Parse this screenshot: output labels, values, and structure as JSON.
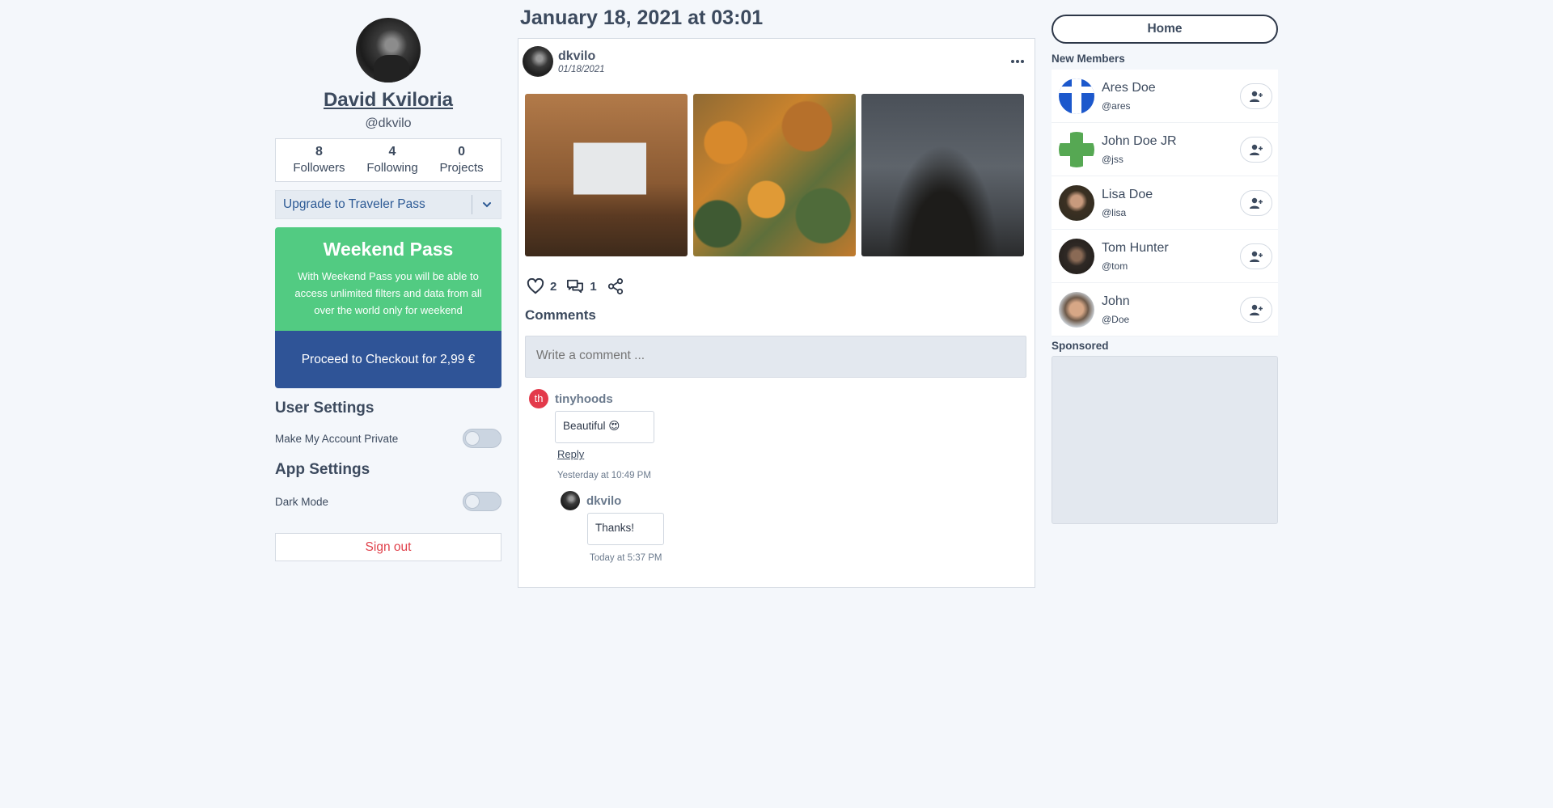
{
  "profile": {
    "name": "David Kviloria",
    "handle": "@dkvilo",
    "stats": [
      {
        "value": "8",
        "label": "Followers"
      },
      {
        "value": "4",
        "label": "Following"
      },
      {
        "value": "0",
        "label": "Projects"
      }
    ]
  },
  "upgrade": {
    "label": "Upgrade to Traveler Pass"
  },
  "pass": {
    "title": "Weekend Pass",
    "description": "With Weekend Pass you will be able to access unlimited filters and data from all over the world only for weekend",
    "checkout_label": "Proceed to Checkout for 2,99 €"
  },
  "user_settings": {
    "heading": "User Settings",
    "private_label": "Make My Account Private",
    "private_on": false
  },
  "app_settings": {
    "heading": "App Settings",
    "dark_mode_label": "Dark Mode",
    "dark_mode_on": false
  },
  "signout_label": "Sign out",
  "post": {
    "date_heading": "January 18, 2021 at 03:01",
    "author": "dkvilo",
    "date": "01/18/2021",
    "likes": "2",
    "comments_count": "1",
    "comments_heading": "Comments",
    "comment_placeholder": "Write a comment ...",
    "comments": [
      {
        "avatar_initials": "th",
        "author": "tinyhoods",
        "text": "Beautiful 😍",
        "reply_label": "Reply",
        "time": "Yesterday at 10:49 PM",
        "replies": [
          {
            "author": "dkvilo",
            "text": "Thanks!",
            "time": "Today at 5:37 PM"
          }
        ]
      }
    ]
  },
  "sidebar": {
    "home_label": "Home",
    "new_members_title": "New Members",
    "members": [
      {
        "name": "Ares Doe",
        "handle": "@ares"
      },
      {
        "name": "John Doe JR",
        "handle": "@jss"
      },
      {
        "name": "Lisa Doe",
        "handle": "@lisa"
      },
      {
        "name": "Tom Hunter",
        "handle": "@tom"
      },
      {
        "name": "John",
        "handle": "@Doe"
      }
    ],
    "sponsored_title": "Sponsored"
  },
  "colors": {
    "accent_green": "#52cb82",
    "accent_blue": "#2f5497",
    "danger": "#e0414b",
    "background": "#f4f7fb"
  }
}
